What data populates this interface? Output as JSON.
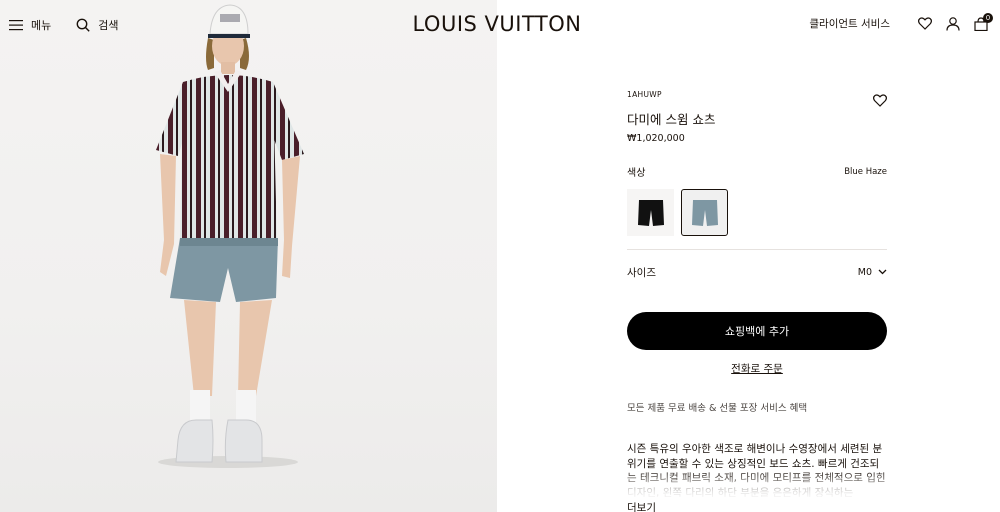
{
  "header": {
    "menu_label": "메뉴",
    "search_label": "검색",
    "logo": "LOUIS VUITTON",
    "client_service": "클라이언트 서비스",
    "bag_count": "0"
  },
  "product": {
    "sku": "1AHUWP",
    "name": "다미에 스윔 쇼츠",
    "price": "₩1,020,000",
    "color_label": "색상",
    "color_value": "Blue Haze",
    "swatches": [
      {
        "name": "Black",
        "color": "#111111"
      },
      {
        "name": "Blue Haze",
        "color": "#7e97a3"
      }
    ],
    "size_label": "사이즈",
    "size_value": "M0",
    "add_to_bag": "쇼핑백에 추가",
    "phone_order": "전화로 주문",
    "benefits": "모든 제품 무료 배송 & 선물 포장 서비스 혜택",
    "description": "시즌 특유의 우아한 색조로 해변이나 수영장에서 세련된 분위기를 연출할 수 있는 상징적인 보드 쇼츠. 빠르게 건조되는 테크니컬 패브릭 소재, 다미에 모티프를 전체적으로 입힌 디자인, 왼쪽 다리의 하단 부분을 은은하게 장식하는",
    "more_label": "더보기"
  },
  "colors": {
    "text": "#19110b",
    "button_bg": "#000000",
    "shirt_stripe_dark": "#4a1f2a",
    "shorts": "#7e97a3"
  }
}
